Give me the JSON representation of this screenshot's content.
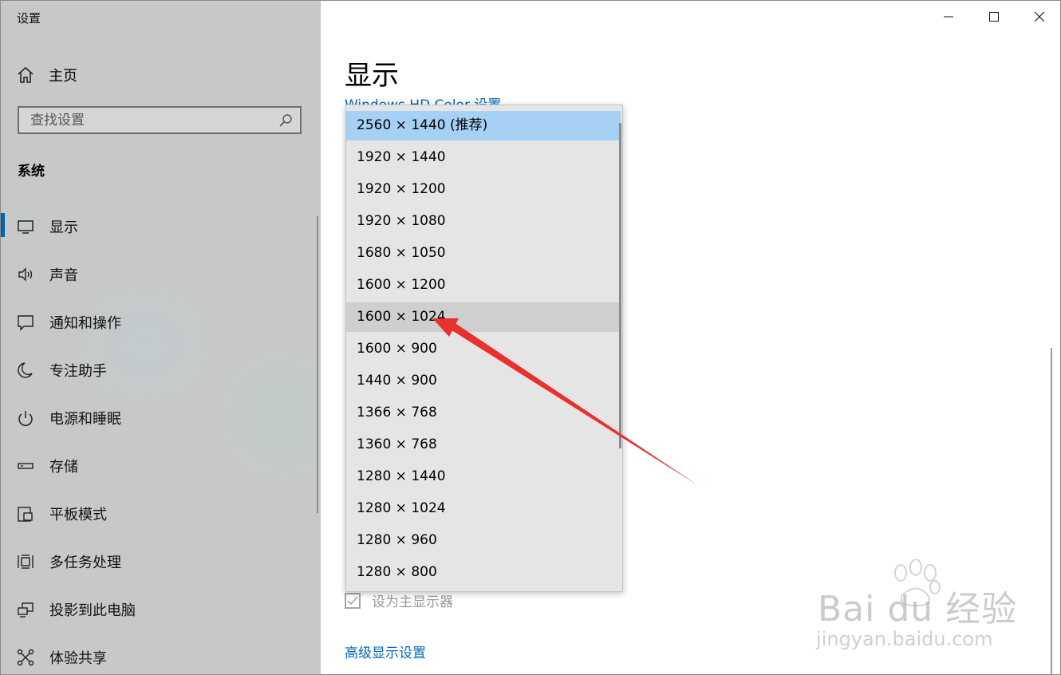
{
  "app": {
    "title": "设置"
  },
  "sidebar": {
    "home_label": "主页",
    "search_placeholder": "查找设置",
    "section_title": "系统",
    "items": [
      {
        "label": "显示",
        "icon": "monitor-icon",
        "active": true
      },
      {
        "label": "声音",
        "icon": "speaker-icon"
      },
      {
        "label": "通知和操作",
        "icon": "notification-icon"
      },
      {
        "label": "专注助手",
        "icon": "moon-icon"
      },
      {
        "label": "电源和睡眠",
        "icon": "power-icon"
      },
      {
        "label": "存储",
        "icon": "storage-icon"
      },
      {
        "label": "平板模式",
        "icon": "tablet-icon"
      },
      {
        "label": "多任务处理",
        "icon": "multitask-icon"
      },
      {
        "label": "投影到此电脑",
        "icon": "project-icon"
      },
      {
        "label": "体验共享",
        "icon": "share-icon"
      }
    ]
  },
  "main": {
    "title": "显示",
    "header_link": "Windows HD Color 设置",
    "primary_display_label": "设为主显示器",
    "advanced_link": "高级显示设置"
  },
  "resolution_dropdown": {
    "selected": "2560 × 1440 (推荐)",
    "hovered": "1600 × 1024",
    "options": [
      "2560 × 1440 (推荐)",
      "1920 × 1440",
      "1920 × 1200",
      "1920 × 1080",
      "1680 × 1050",
      "1600 × 1200",
      "1600 × 1024",
      "1600 × 900",
      "1440 × 900",
      "1366 × 768",
      "1360 × 768",
      "1280 × 1440",
      "1280 × 1024",
      "1280 × 960",
      "1280 × 800"
    ]
  },
  "watermark": {
    "brand": "Bai du 经验",
    "url": "jingyan.baidu.com"
  },
  "colors": {
    "accent": "#0063b1",
    "link": "#0067b8",
    "selected": "#a6d1f4",
    "annotation_arrow": "#e8312f"
  }
}
